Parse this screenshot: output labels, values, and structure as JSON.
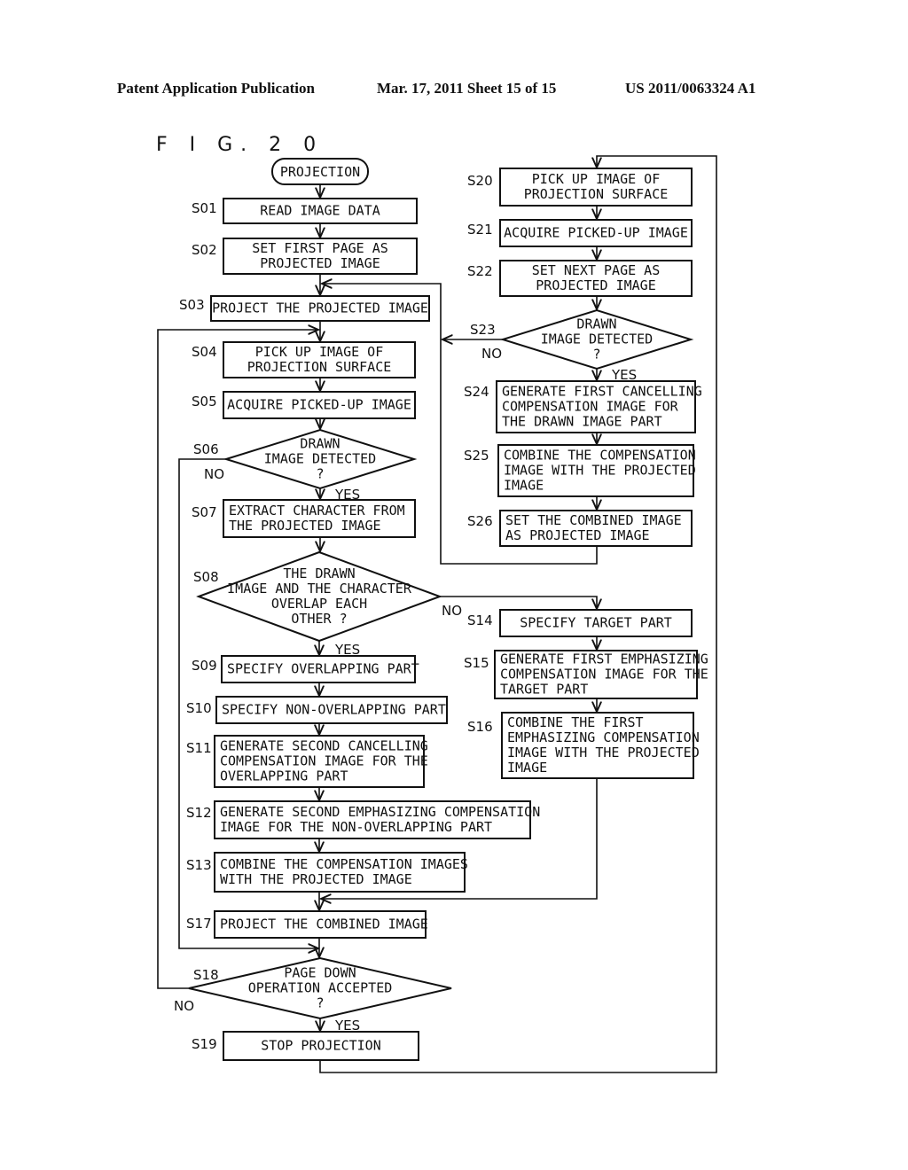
{
  "header": {
    "left": "Patent Application Publication",
    "middle": "Mar. 17, 2011  Sheet 15 of 15",
    "right": "US 2011/0063324 A1"
  },
  "figure": {
    "title": "F I G. 2 0",
    "start": "PROJECTION",
    "steps": {
      "S01": {
        "id": "S01",
        "lines": [
          "READ IMAGE DATA"
        ]
      },
      "S02": {
        "id": "S02",
        "lines": [
          "SET FIRST PAGE AS",
          "PROJECTED IMAGE"
        ]
      },
      "S03": {
        "id": "S03",
        "lines": [
          "PROJECT THE PROJECTED IMAGE"
        ]
      },
      "S04": {
        "id": "S04",
        "lines": [
          "PICK UP IMAGE OF",
          "PROJECTION SURFACE"
        ]
      },
      "S05": {
        "id": "S05",
        "lines": [
          "ACQUIRE PICKED-UP IMAGE"
        ]
      },
      "S06": {
        "id": "S06",
        "lines": [
          "DRAWN",
          "IMAGE DETECTED",
          "?"
        ],
        "yes": "YES",
        "no": "NO"
      },
      "S07": {
        "id": "S07",
        "lines": [
          "EXTRACT CHARACTER FROM",
          "THE PROJECTED IMAGE"
        ]
      },
      "S08": {
        "id": "S08",
        "lines": [
          "THE DRAWN",
          "IMAGE AND THE CHARACTER",
          "OVERLAP EACH",
          "OTHER ?"
        ],
        "yes": "YES",
        "no": "NO"
      },
      "S09": {
        "id": "S09",
        "lines": [
          "SPECIFY OVERLAPPING PART"
        ]
      },
      "S10": {
        "id": "S10",
        "lines": [
          "SPECIFY NON-OVERLAPPING PART"
        ]
      },
      "S11": {
        "id": "S11",
        "lines": [
          "GENERATE SECOND CANCELLING",
          "COMPENSATION IMAGE FOR THE",
          "OVERLAPPING PART"
        ]
      },
      "S12": {
        "id": "S12",
        "lines": [
          "GENERATE SECOND EMPHASIZING COMPENSATION",
          "IMAGE FOR THE NON-OVERLAPPING PART"
        ]
      },
      "S13": {
        "id": "S13",
        "lines": [
          "COMBINE THE COMPENSATION IMAGES",
          "WITH THE PROJECTED IMAGE"
        ]
      },
      "S14": {
        "id": "S14",
        "lines": [
          "SPECIFY TARGET PART"
        ]
      },
      "S15": {
        "id": "S15",
        "lines": [
          "GENERATE FIRST EMPHASIZING",
          "COMPENSATION IMAGE FOR THE",
          "TARGET PART"
        ]
      },
      "S16": {
        "id": "S16",
        "lines": [
          "COMBINE THE FIRST",
          "EMPHASIZING COMPENSATION",
          "IMAGE WITH THE PROJECTED",
          "IMAGE"
        ]
      },
      "S17": {
        "id": "S17",
        "lines": [
          "PROJECT THE COMBINED IMAGE"
        ]
      },
      "S18": {
        "id": "S18",
        "lines": [
          "PAGE DOWN",
          "OPERATION ACCEPTED",
          "?"
        ],
        "yes": "YES",
        "no": "NO"
      },
      "S19": {
        "id": "S19",
        "lines": [
          "STOP PROJECTION"
        ]
      },
      "S20": {
        "id": "S20",
        "lines": [
          "PICK UP IMAGE OF",
          "PROJECTION SURFACE"
        ]
      },
      "S21": {
        "id": "S21",
        "lines": [
          "ACQUIRE PICKED-UP IMAGE"
        ]
      },
      "S22": {
        "id": "S22",
        "lines": [
          "SET NEXT PAGE AS",
          "PROJECTED IMAGE"
        ]
      },
      "S23": {
        "id": "S23",
        "lines": [
          "DRAWN",
          "IMAGE DETECTED",
          "?"
        ],
        "yes": "YES",
        "no": "NO"
      },
      "S24": {
        "id": "S24",
        "lines": [
          "GENERATE FIRST CANCELLING",
          "COMPENSATION IMAGE FOR",
          "THE DRAWN IMAGE PART"
        ]
      },
      "S25": {
        "id": "S25",
        "lines": [
          "COMBINE THE COMPENSATION",
          "IMAGE WITH THE PROJECTED",
          "IMAGE"
        ]
      },
      "S26": {
        "id": "S26",
        "lines": [
          "SET THE COMBINED IMAGE",
          "AS PROJECTED IMAGE"
        ]
      }
    }
  }
}
